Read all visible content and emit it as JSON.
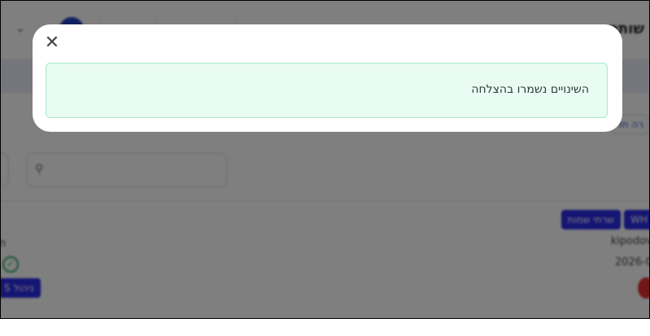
{
  "background": {
    "page_title": "שותפ",
    "link_partial": "רה חד",
    "tags": [
      "שרתי שמות",
      "WH"
    ],
    "username_partial": "kipodov",
    "date_partial": "2026-0",
    "left_button_partial": "ניהול S"
  },
  "modal": {
    "message": "השינויים נשמרו בהצלחה",
    "close_glyph": "✕"
  },
  "colors": {
    "success_bg": "#e9fcf4",
    "success_border": "#a7e8c7",
    "tag_blue": "#2a2ae8"
  }
}
